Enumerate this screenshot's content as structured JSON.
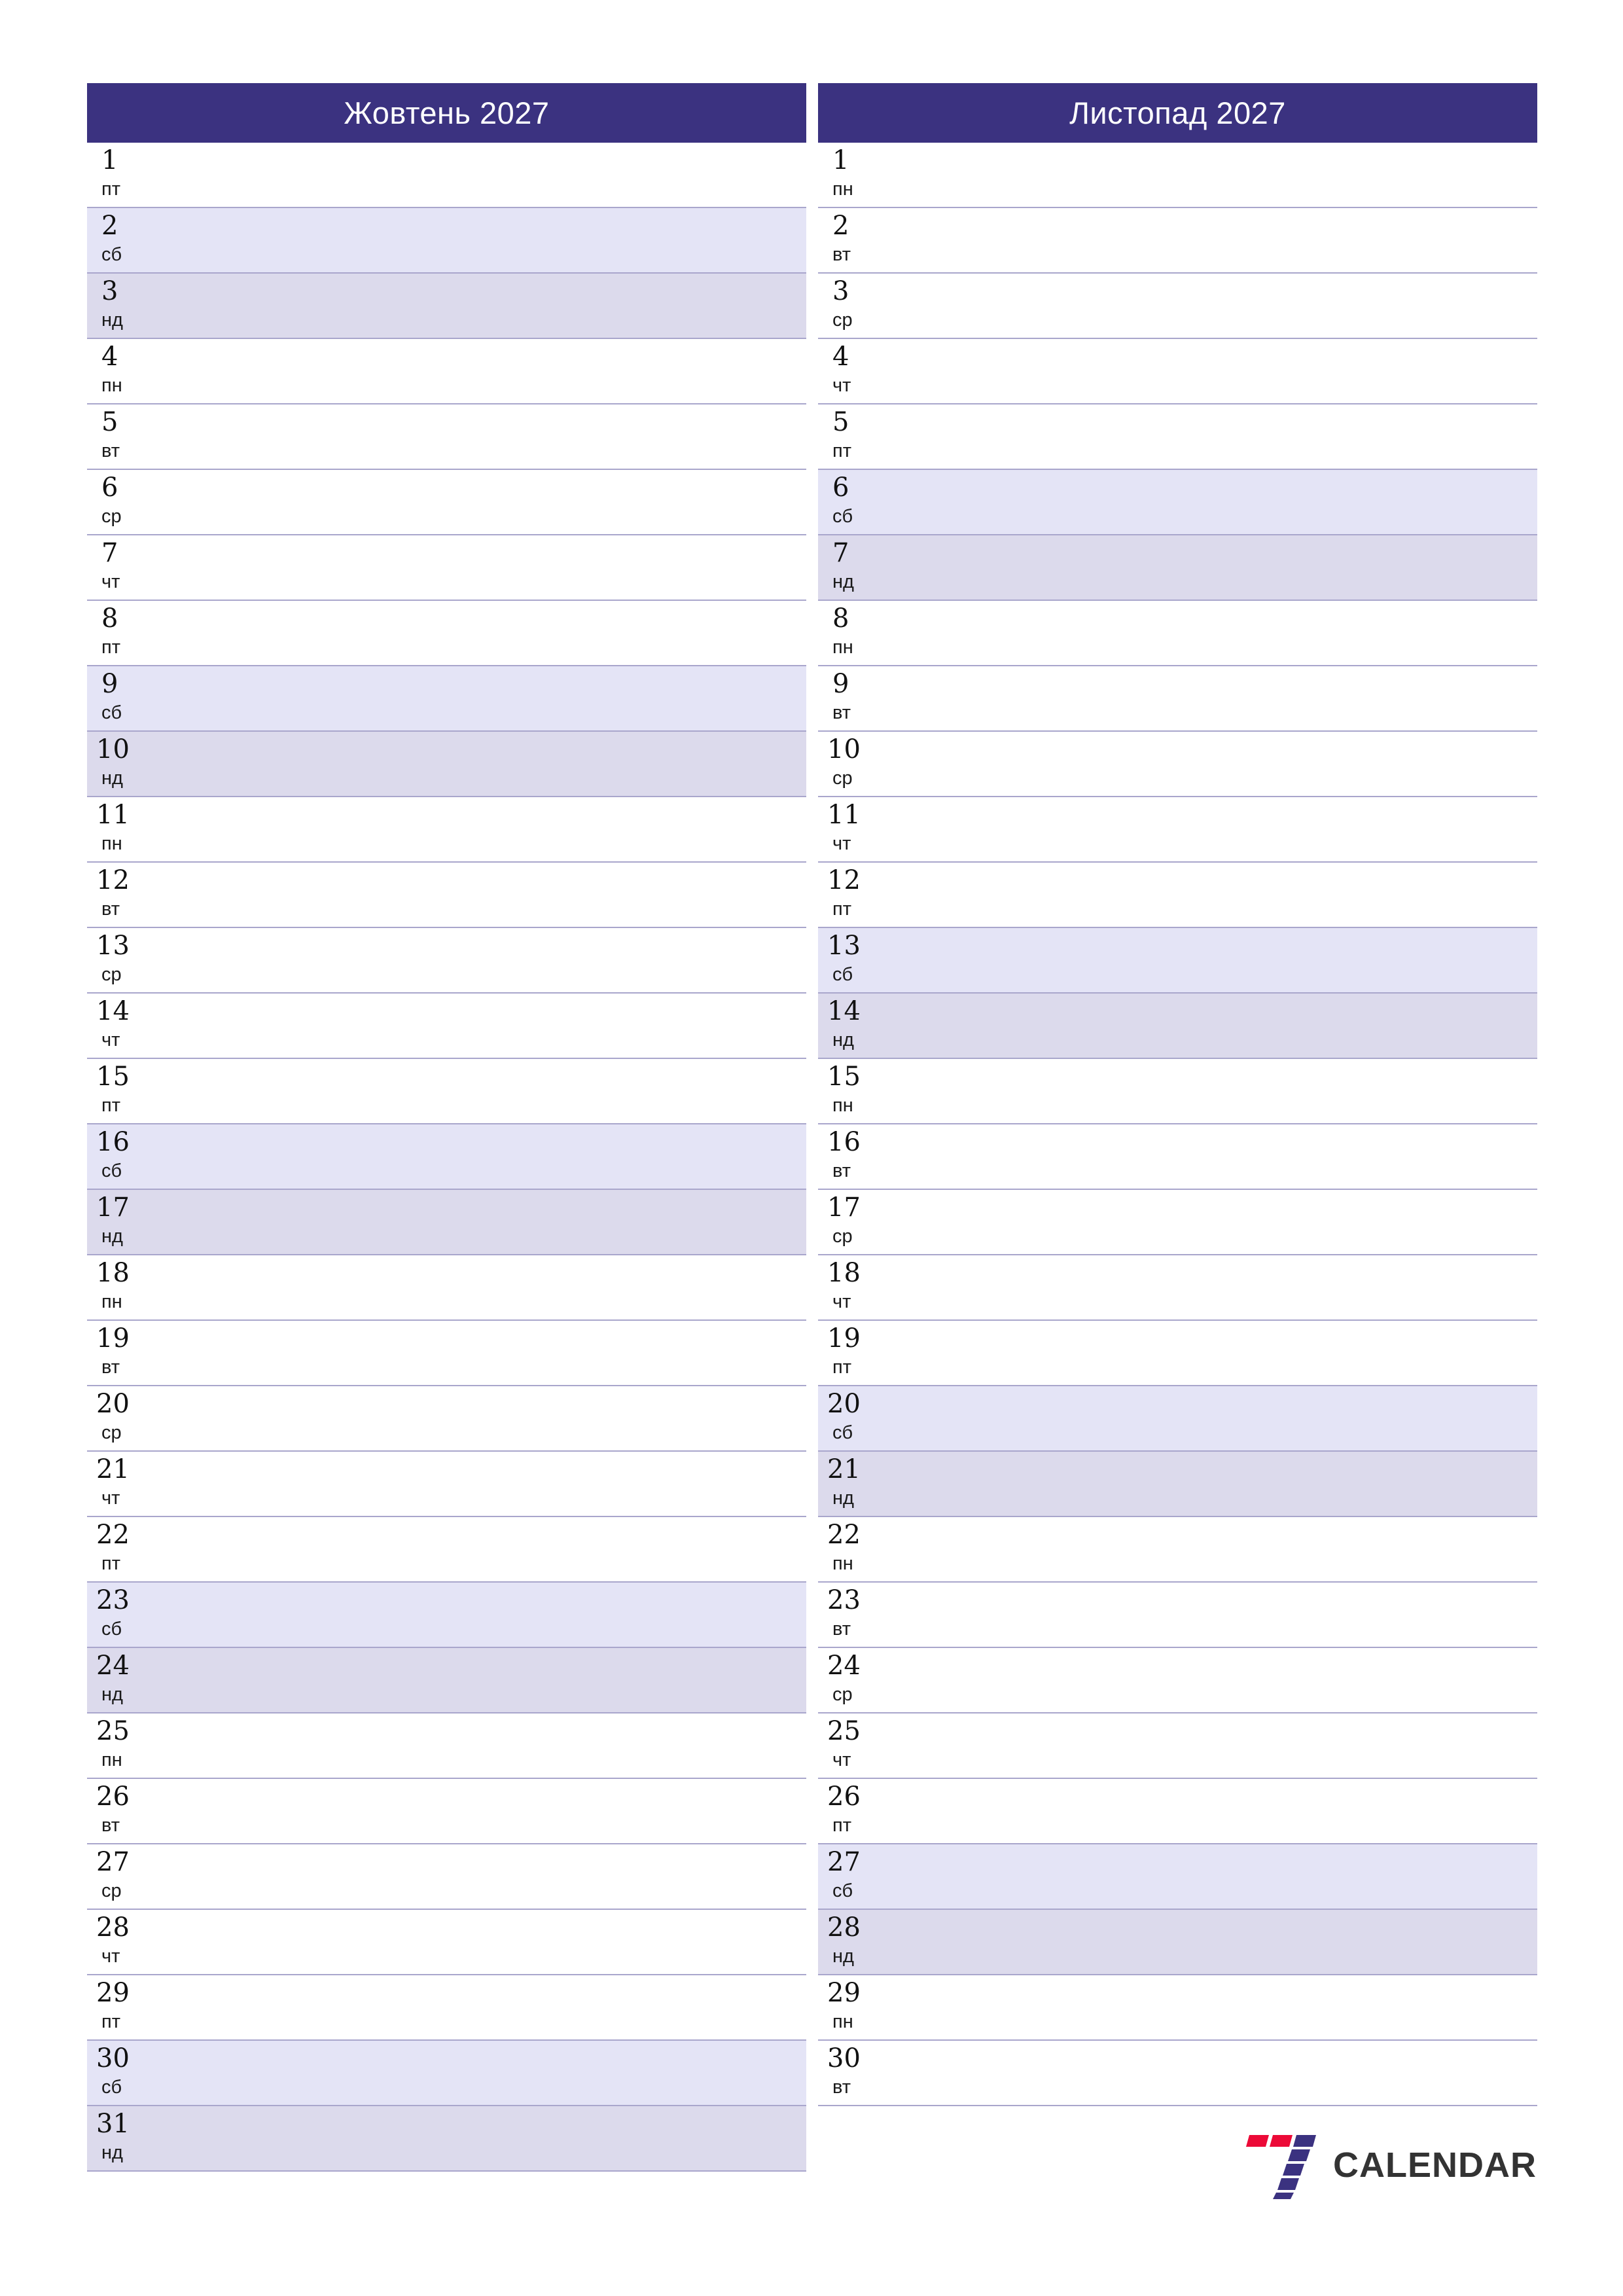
{
  "document": {
    "kind": "monthly-planner-calendar",
    "page_background": "#ffffff"
  },
  "colors": {
    "header_bg": "#3b3280",
    "header_text": "#ffffff",
    "saturday_bg": "#e4e4f6",
    "sunday_bg": "#dcdaec",
    "row_divider": "#a9a6cc",
    "day_number_text": "#111111",
    "logo_red": "#ec0a37",
    "logo_purple": "#3b3280",
    "logo_text": "#333333"
  },
  "months": [
    {
      "title": "Жовтень 2027",
      "name": "Жовтень",
      "year": "2027",
      "days": [
        {
          "num": "1",
          "weekday": "пт",
          "kind": "weekday"
        },
        {
          "num": "2",
          "weekday": "сб",
          "kind": "saturday"
        },
        {
          "num": "3",
          "weekday": "нд",
          "kind": "sunday"
        },
        {
          "num": "4",
          "weekday": "пн",
          "kind": "weekday"
        },
        {
          "num": "5",
          "weekday": "вт",
          "kind": "weekday"
        },
        {
          "num": "6",
          "weekday": "ср",
          "kind": "weekday"
        },
        {
          "num": "7",
          "weekday": "чт",
          "kind": "weekday"
        },
        {
          "num": "8",
          "weekday": "пт",
          "kind": "weekday"
        },
        {
          "num": "9",
          "weekday": "сб",
          "kind": "saturday"
        },
        {
          "num": "10",
          "weekday": "нд",
          "kind": "sunday"
        },
        {
          "num": "11",
          "weekday": "пн",
          "kind": "weekday"
        },
        {
          "num": "12",
          "weekday": "вт",
          "kind": "weekday"
        },
        {
          "num": "13",
          "weekday": "ср",
          "kind": "weekday"
        },
        {
          "num": "14",
          "weekday": "чт",
          "kind": "weekday"
        },
        {
          "num": "15",
          "weekday": "пт",
          "kind": "weekday"
        },
        {
          "num": "16",
          "weekday": "сб",
          "kind": "saturday"
        },
        {
          "num": "17",
          "weekday": "нд",
          "kind": "sunday"
        },
        {
          "num": "18",
          "weekday": "пн",
          "kind": "weekday"
        },
        {
          "num": "19",
          "weekday": "вт",
          "kind": "weekday"
        },
        {
          "num": "20",
          "weekday": "ср",
          "kind": "weekday"
        },
        {
          "num": "21",
          "weekday": "чт",
          "kind": "weekday"
        },
        {
          "num": "22",
          "weekday": "пт",
          "kind": "weekday"
        },
        {
          "num": "23",
          "weekday": "сб",
          "kind": "saturday"
        },
        {
          "num": "24",
          "weekday": "нд",
          "kind": "sunday"
        },
        {
          "num": "25",
          "weekday": "пн",
          "kind": "weekday"
        },
        {
          "num": "26",
          "weekday": "вт",
          "kind": "weekday"
        },
        {
          "num": "27",
          "weekday": "ср",
          "kind": "weekday"
        },
        {
          "num": "28",
          "weekday": "чт",
          "kind": "weekday"
        },
        {
          "num": "29",
          "weekday": "пт",
          "kind": "weekday"
        },
        {
          "num": "30",
          "weekday": "сб",
          "kind": "saturday"
        },
        {
          "num": "31",
          "weekday": "нд",
          "kind": "sunday"
        }
      ]
    },
    {
      "title": "Листопад 2027",
      "name": "Листопад",
      "year": "2027",
      "days": [
        {
          "num": "1",
          "weekday": "пн",
          "kind": "weekday"
        },
        {
          "num": "2",
          "weekday": "вт",
          "kind": "weekday"
        },
        {
          "num": "3",
          "weekday": "ср",
          "kind": "weekday"
        },
        {
          "num": "4",
          "weekday": "чт",
          "kind": "weekday"
        },
        {
          "num": "5",
          "weekday": "пт",
          "kind": "weekday"
        },
        {
          "num": "6",
          "weekday": "сб",
          "kind": "saturday"
        },
        {
          "num": "7",
          "weekday": "нд",
          "kind": "sunday"
        },
        {
          "num": "8",
          "weekday": "пн",
          "kind": "weekday"
        },
        {
          "num": "9",
          "weekday": "вт",
          "kind": "weekday"
        },
        {
          "num": "10",
          "weekday": "ср",
          "kind": "weekday"
        },
        {
          "num": "11",
          "weekday": "чт",
          "kind": "weekday"
        },
        {
          "num": "12",
          "weekday": "пт",
          "kind": "weekday"
        },
        {
          "num": "13",
          "weekday": "сб",
          "kind": "saturday"
        },
        {
          "num": "14",
          "weekday": "нд",
          "kind": "sunday"
        },
        {
          "num": "15",
          "weekday": "пн",
          "kind": "weekday"
        },
        {
          "num": "16",
          "weekday": "вт",
          "kind": "weekday"
        },
        {
          "num": "17",
          "weekday": "ср",
          "kind": "weekday"
        },
        {
          "num": "18",
          "weekday": "чт",
          "kind": "weekday"
        },
        {
          "num": "19",
          "weekday": "пт",
          "kind": "weekday"
        },
        {
          "num": "20",
          "weekday": "сб",
          "kind": "saturday"
        },
        {
          "num": "21",
          "weekday": "нд",
          "kind": "sunday"
        },
        {
          "num": "22",
          "weekday": "пн",
          "kind": "weekday"
        },
        {
          "num": "23",
          "weekday": "вт",
          "kind": "weekday"
        },
        {
          "num": "24",
          "weekday": "ср",
          "kind": "weekday"
        },
        {
          "num": "25",
          "weekday": "чт",
          "kind": "weekday"
        },
        {
          "num": "26",
          "weekday": "пт",
          "kind": "weekday"
        },
        {
          "num": "27",
          "weekday": "сб",
          "kind": "saturday"
        },
        {
          "num": "28",
          "weekday": "нд",
          "kind": "sunday"
        },
        {
          "num": "29",
          "weekday": "пн",
          "kind": "weekday"
        },
        {
          "num": "30",
          "weekday": "вт",
          "kind": "weekday"
        },
        {
          "num": "",
          "weekday": "",
          "kind": "empty"
        }
      ]
    }
  ],
  "logo": {
    "mark": "seven-logo-icon",
    "text": "CALENDAR"
  }
}
